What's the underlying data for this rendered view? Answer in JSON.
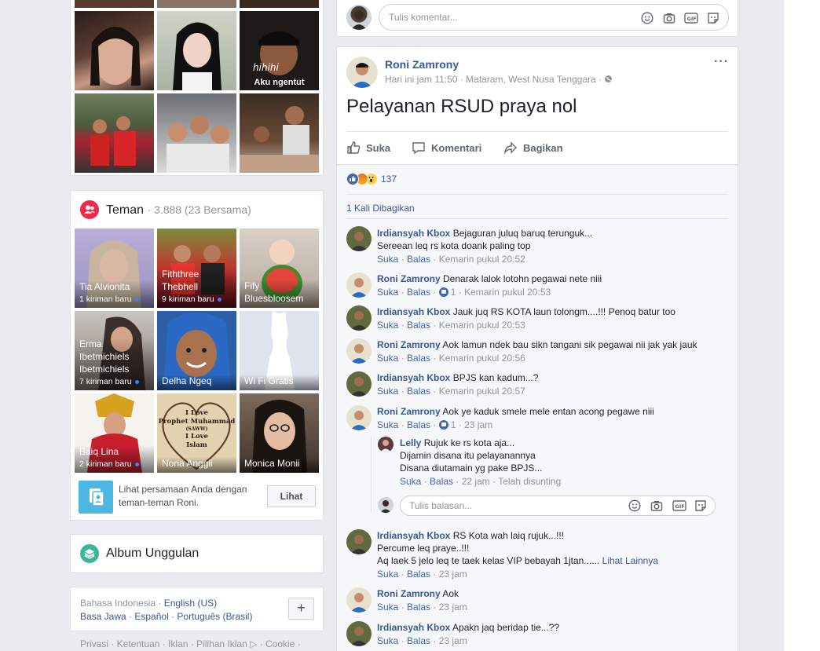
{
  "colors": {
    "page_bg": "#e9ebee",
    "link": "#385898",
    "accent": "#4267b2",
    "friends_icon": "#f02849",
    "album_icon": "#3ab795"
  },
  "photos_top": [
    {
      "icon": "woman-portrait"
    },
    {
      "icon": "woman-portrait"
    },
    {
      "icon": "boy-with-cap",
      "caption": "Aku ngentut"
    },
    {
      "icon": "group-outdoor"
    },
    {
      "icon": "group-selfie"
    },
    {
      "icon": "men-at-table"
    }
  ],
  "friends": {
    "title": "Teman",
    "count": "· 3.888 (23 Bersama)",
    "items": [
      {
        "name": "Tia Alvionita",
        "new": "1 kiriman baru"
      },
      {
        "name": "Fiththree Thebhell",
        "new": "9 kiriman baru"
      },
      {
        "name": "Fify Bluesbloosem",
        "new": ""
      },
      {
        "name": "Erma Ibetmichiels Ibetmichiels",
        "new": "7 kiriman baru"
      },
      {
        "name": "Delha Ngeq",
        "new": ""
      },
      {
        "name": "Wi Fi Gratis",
        "new": ""
      },
      {
        "name": "Baiq Lina",
        "new": "2 kiriman baru"
      },
      {
        "name": "Nona Anggii",
        "new": ""
      },
      {
        "name": "Monica Monii",
        "new": ""
      }
    ],
    "mutual_text": "Lihat persamaan Anda dengan teman-teman Roni.",
    "mutual_button": "Lihat",
    "heart_text": [
      "I Love",
      "Prophet Muhammad",
      "(SAWW)",
      "I Love",
      "Islam"
    ]
  },
  "album": {
    "title": "Album Unggulan"
  },
  "languages": {
    "current": "Bahasa Indonesia · ",
    "items": [
      "English (US)",
      "Basa Jawa",
      "Español",
      "Português (Brasil)"
    ],
    "seps": [
      " · ",
      " · "
    ],
    "add": "+"
  },
  "footer_links": "Privasi · Ketentuan · Iklan · Pilihan Iklan ▷ · Cookie ·",
  "top_comment": {
    "placeholder": "Tulis komentar..."
  },
  "post": {
    "author": "Roni Zamrony",
    "time": "Hari ini jam 11:50",
    "location": " · Mataram, West Nusa Tenggara · ",
    "text": "Pelayanan RSUD praya nol",
    "actions": {
      "like": "Suka",
      "comment": "Komentari",
      "share": "Bagikan"
    },
    "reactions_count": "137",
    "shares": "1 Kali Dibagikan",
    "comments": [
      {
        "author": "Irdiansyah Kbox",
        "lines": [
          "Bejaguran juluq baruq terunguk...",
          "Sereean leq rs kota doank paling top"
        ],
        "like_count": "",
        "time": "Kemarin pukul 20:52"
      },
      {
        "author": "Roni Zamrony",
        "lines": [
          "Denarak lalok lotohn pegawai nete niii"
        ],
        "like_count": "1",
        "time": "Kemarin pukul 20:53"
      },
      {
        "author": "Irdiansyah Kbox",
        "lines": [
          "Jauk juq RS KOTA laun tolongm....!!! Penoq batur too"
        ],
        "like_count": "",
        "time": "Kemarin pukul 20:53"
      },
      {
        "author": "Roni Zamrony",
        "lines": [
          "Aok lamun ndek bau sikn tangani sik pegawai nii jak yak jauk"
        ],
        "like_count": "",
        "time": "Kemarin pukul 20:56"
      },
      {
        "author": "Irdiansyah Kbox",
        "lines": [
          "BPJS kan kadum...?"
        ],
        "like_count": "",
        "time": "Kemarin pukul 20:57"
      },
      {
        "author": "Roni Zamrony",
        "lines": [
          "Aok ye kaduk smele mele entan acong pegawe niii"
        ],
        "like_count": "1",
        "time": "23 jam"
      }
    ],
    "reply": {
      "author": "Lelly",
      "lines": [
        "Rujuk ke rs kota aja...",
        "Dijamin disana itu pelayanannya",
        "Disana diutamain yg pake BPJS..."
      ],
      "time": "22 jam",
      "edited": "Telah disunting"
    },
    "reply_placeholder": "Tulis balasan...",
    "comments2": [
      {
        "author": "Irdiansyah Kbox",
        "lines": [
          "RS Kota wah laiq rujuk...!!!",
          "Percume leq praye..!!!",
          "Aq laek 5 jelo leq te taek kelas VIP bebayah 1jtan......"
        ],
        "more": "Lihat Lainnya",
        "time": "23 jam"
      },
      {
        "author": "Roni Zamrony",
        "lines": [
          "Aok"
        ],
        "time": "23 jam"
      },
      {
        "author": "Irdiansyah Kbox",
        "lines": [
          "Apakn jaq beridap tie...??"
        ],
        "time": "23 jam"
      }
    ],
    "like_label": "Suka",
    "reply_label": "Balas"
  }
}
